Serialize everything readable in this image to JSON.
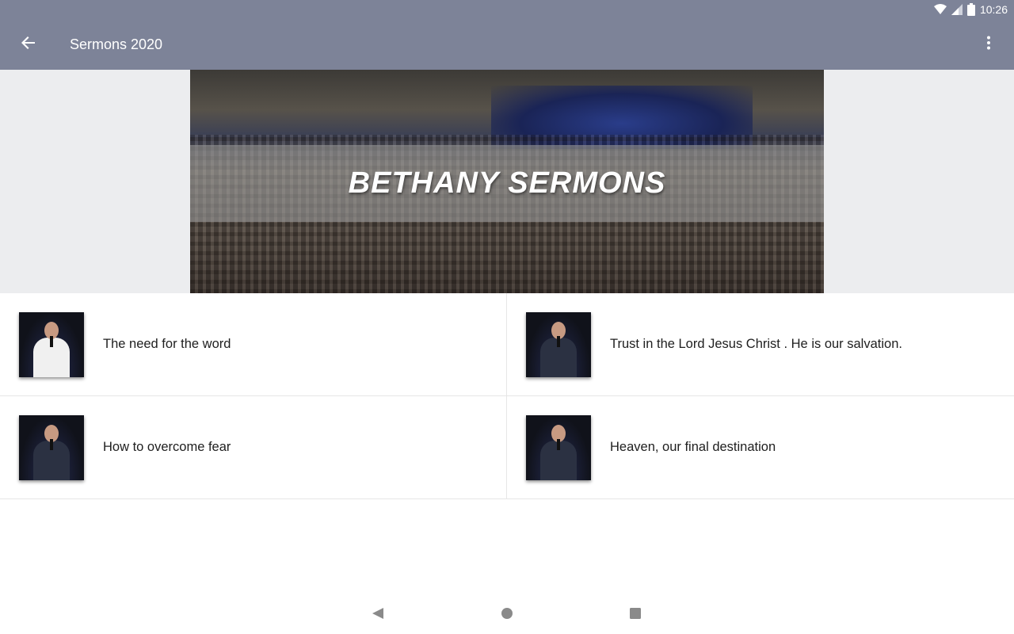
{
  "status_bar": {
    "time": "10:26",
    "wifi_icon": "wifi-icon",
    "signal_icon": "signal-icon",
    "battery_icon": "battery-icon"
  },
  "app_bar": {
    "title": "Sermons 2020",
    "back_icon": "arrow-back-icon",
    "menu_icon": "more-vert-icon"
  },
  "banner": {
    "text": "BETHANY SERMONS"
  },
  "sermons": [
    {
      "title": "The need for the word",
      "robe": "white"
    },
    {
      "title": "Trust in the Lord Jesus Christ . He is our salvation.",
      "robe": "dark"
    },
    {
      "title": "How to overcome fear",
      "robe": "dark"
    },
    {
      "title": "Heaven, our final destination",
      "robe": "dark"
    }
  ],
  "nav_bar": {
    "back": "nav-back-icon",
    "home": "nav-home-icon",
    "recents": "nav-recents-icon"
  },
  "colors": {
    "app_bar": "#7d8398",
    "banner_background": "#ecedef",
    "divider": "#e6e6e6",
    "text": "#202020"
  }
}
